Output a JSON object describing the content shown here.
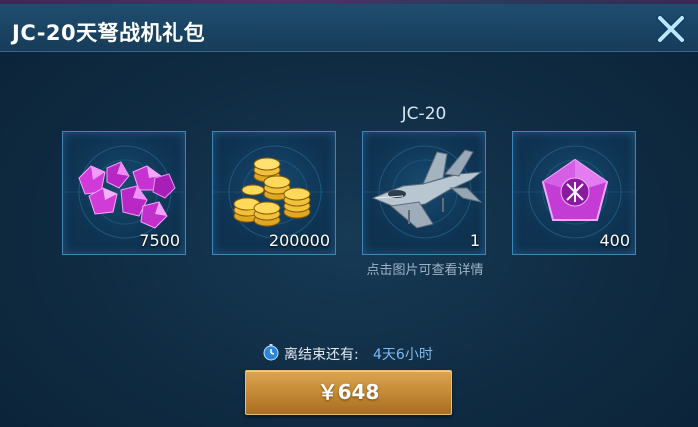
{
  "dialog": {
    "title": "JC-20天弩战机礼包"
  },
  "items": [
    {
      "name": "purple-gems",
      "icon": "purple-gem-pile-icon",
      "count": "7500"
    },
    {
      "name": "gold-coins",
      "icon": "gold-coin-stack-icon",
      "count": "200000"
    },
    {
      "name": "jc20-fighter",
      "icon": "fighter-jet-icon",
      "label": "JC-20",
      "count": "1"
    },
    {
      "name": "pentagon-crystal",
      "icon": "purple-pentagon-crystal-icon",
      "count": "400"
    }
  ],
  "hint": "点击图片可查看详情",
  "timer": {
    "icon": "stopwatch-icon",
    "label": "离结束还有:",
    "value": "4天6小时"
  },
  "buy_button": {
    "label": "￥648"
  },
  "colors": {
    "title_bar": "#1f4d70",
    "item_border": "#3f86b8",
    "button_gold": "#c58a36",
    "timer_value": "#7fb8f0"
  }
}
